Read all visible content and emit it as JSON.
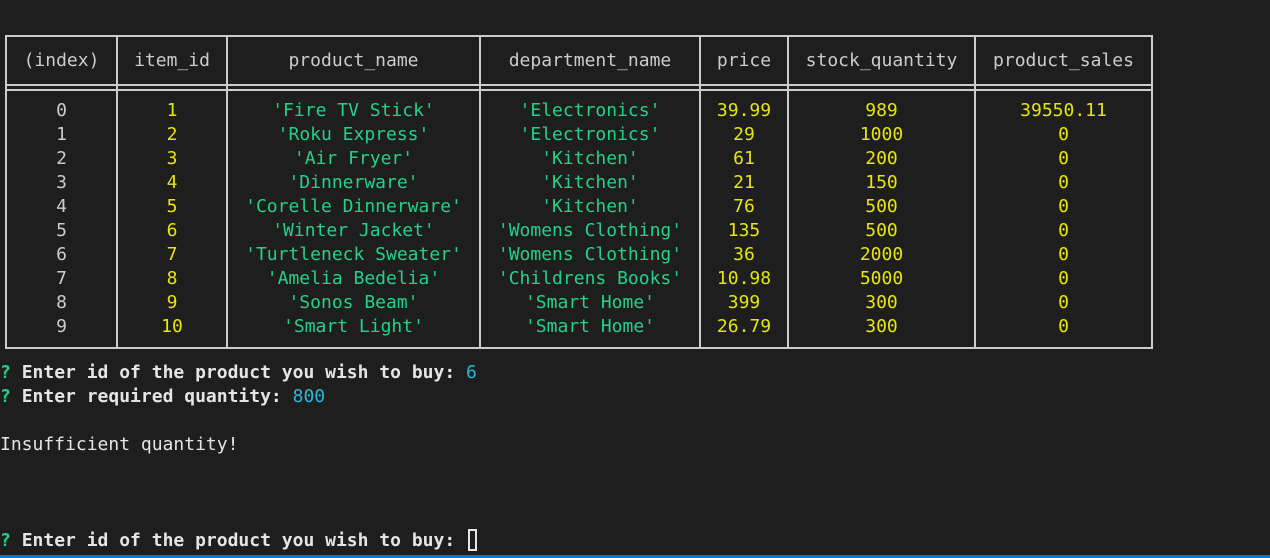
{
  "table": {
    "columns": [
      "(index)",
      "item_id",
      "product_name",
      "department_name",
      "price",
      "stock_quantity",
      "product_sales"
    ],
    "rows": [
      {
        "index": "0",
        "item_id": "1",
        "product_name": "'Fire TV Stick'",
        "department_name": "'Electronics'",
        "price": "39.99",
        "stock_quantity": "989",
        "product_sales": "39550.11"
      },
      {
        "index": "1",
        "item_id": "2",
        "product_name": "'Roku Express'",
        "department_name": "'Electronics'",
        "price": "29",
        "stock_quantity": "1000",
        "product_sales": "0"
      },
      {
        "index": "2",
        "item_id": "3",
        "product_name": "'Air Fryer'",
        "department_name": "'Kitchen'",
        "price": "61",
        "stock_quantity": "200",
        "product_sales": "0"
      },
      {
        "index": "3",
        "item_id": "4",
        "product_name": "'Dinnerware'",
        "department_name": "'Kitchen'",
        "price": "21",
        "stock_quantity": "150",
        "product_sales": "0"
      },
      {
        "index": "4",
        "item_id": "5",
        "product_name": "'Corelle Dinnerware'",
        "department_name": "'Kitchen'",
        "price": "76",
        "stock_quantity": "500",
        "product_sales": "0"
      },
      {
        "index": "5",
        "item_id": "6",
        "product_name": "'Winter Jacket'",
        "department_name": "'Womens Clothing'",
        "price": "135",
        "stock_quantity": "500",
        "product_sales": "0"
      },
      {
        "index": "6",
        "item_id": "7",
        "product_name": "'Turtleneck Sweater'",
        "department_name": "'Womens Clothing'",
        "price": "36",
        "stock_quantity": "2000",
        "product_sales": "0"
      },
      {
        "index": "7",
        "item_id": "8",
        "product_name": "'Amelia Bedelia'",
        "department_name": "'Childrens Books'",
        "price": "10.98",
        "stock_quantity": "5000",
        "product_sales": "0"
      },
      {
        "index": "8",
        "item_id": "9",
        "product_name": "'Sonos Beam'",
        "department_name": "'Smart Home'",
        "price": "399",
        "stock_quantity": "300",
        "product_sales": "0"
      },
      {
        "index": "9",
        "item_id": "10",
        "product_name": "'Smart Light'",
        "department_name": "'Smart Home'",
        "price": "26.79",
        "stock_quantity": "300",
        "product_sales": "0"
      }
    ]
  },
  "prompts": {
    "q_mark": "?",
    "id_question": "Enter id of the product you wish to buy:",
    "id_answer": "6",
    "qty_question": "Enter required quantity:",
    "qty_answer": "800",
    "message": "Insufficient quantity!",
    "next_question": "Enter id of the product you wish to buy:"
  },
  "colors": {
    "background": "#1e1e1e",
    "border": "#cccccc",
    "number": "#e5e510",
    "string": "#23d18b",
    "answer": "#29b8db",
    "status_bar": "#007acc"
  }
}
